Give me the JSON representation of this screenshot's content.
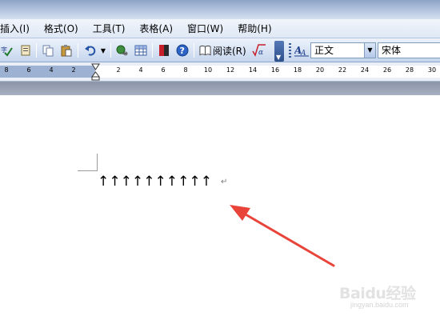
{
  "title_bar": {
    "text": ""
  },
  "menu": {
    "items": [
      {
        "label": "插入(I)"
      },
      {
        "label": "格式(O)"
      },
      {
        "label": "工具(T)"
      },
      {
        "label": "表格(A)"
      },
      {
        "label": "窗口(W)"
      },
      {
        "label": "帮助(H)"
      }
    ]
  },
  "toolbar": {
    "reading_label": "阅读(R)",
    "style_value": "正文",
    "font_value": "宋体"
  },
  "ruler": {
    "left_labels": [
      "8",
      "6",
      "4",
      "2"
    ],
    "right_labels": [
      "2",
      "4",
      "6",
      "8",
      "10",
      "12",
      "14",
      "16",
      "18",
      "20",
      "22",
      "24",
      "26",
      "28",
      "30"
    ]
  },
  "document": {
    "arrows": [
      "↑",
      "↑",
      "↑",
      "↑",
      "↑",
      "↑",
      "↑",
      "↑",
      "↑",
      "↑"
    ],
    "paragraph_mark": "↵"
  },
  "watermark": {
    "logo_text": "Baidu经验",
    "sub_text": "jingyan.baidu.com"
  },
  "colors": {
    "annotation_arrow": "#e8443a",
    "ruler_dark": "#9db1d3",
    "toolbar_border": "#8da6cc"
  }
}
